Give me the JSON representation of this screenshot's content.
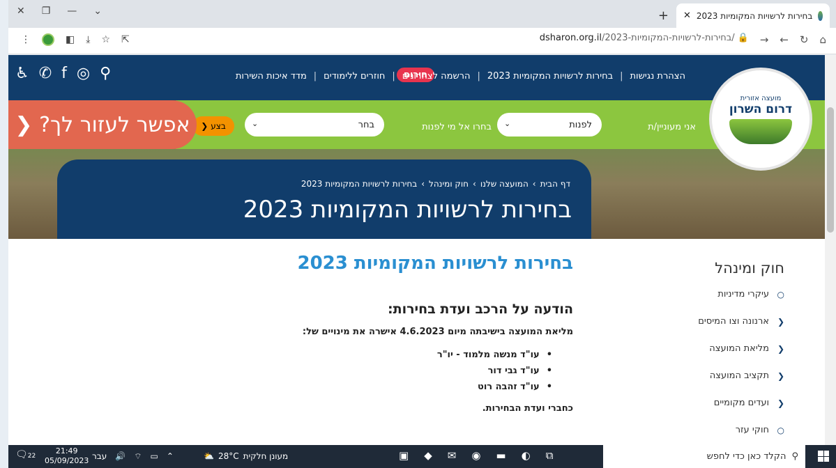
{
  "browser": {
    "tab_title": "בחירות לרשויות המקומיות 2023",
    "url_host": "dsharon.org.il",
    "url_path": "/בחירות-לרשויות-המקומיות-2023/"
  },
  "site": {
    "logo_line1": "מועצה אזורית",
    "logo_line2": "דרום השרון",
    "nav": [
      "הצהרת נגישות",
      "בחירות לרשויות המקומיות 2023",
      "הרשמה לצהרונים",
      "חוזרים ללימודים",
      "מדד איכות השירות"
    ],
    "emergency": "חירום",
    "finder": {
      "label1": "אני מעוניין/ת",
      "select1": "לפנות",
      "label2": "בחרו אל מי לפנות",
      "select2": "בחר",
      "go": "בצע"
    },
    "help": "אפשר לעזור לך?",
    "breadcrumbs": [
      "דף הבית",
      "המועצה שלנו",
      "חוק ומינהל",
      "בחירות לרשויות המקומיות 2023"
    ],
    "page_title": "בחירות לרשויות המקומיות 2023"
  },
  "content": {
    "heading": "בחירות לרשויות המקומיות 2023",
    "subheading": "הודעה על הרכב ועדת בחירות:",
    "para": "מליאת המועצה בישיבתה מיום 4.6.2023 אישרה את מינויים של:",
    "list": [
      "עו\"ד מנשה מלמוד - יו\"ר",
      "עו\"ד גבי דור",
      "עו\"ד זהבה רוט"
    ],
    "para2": "כחברי ועדת הבחירות."
  },
  "sidebar": {
    "title": "חוק ומינהל",
    "items": [
      {
        "label": "עיקרי מדיניות",
        "icon": "○"
      },
      {
        "label": "ארנונה וצו המיסים",
        "icon": "❮"
      },
      {
        "label": "מליאת המועצה",
        "icon": "❮"
      },
      {
        "label": "תקציב המועצה",
        "icon": "❮"
      },
      {
        "label": "ועדים מקומיים",
        "icon": "❮"
      },
      {
        "label": "חוקי עזר",
        "icon": "○"
      }
    ]
  },
  "taskbar": {
    "search": "הקלד כאן כדי לחפש",
    "weather": "מעונן חלקית",
    "temp": "28°C",
    "lang": "עבר",
    "time": "21:49",
    "date": "05/09/2023",
    "notif_count": "22"
  }
}
